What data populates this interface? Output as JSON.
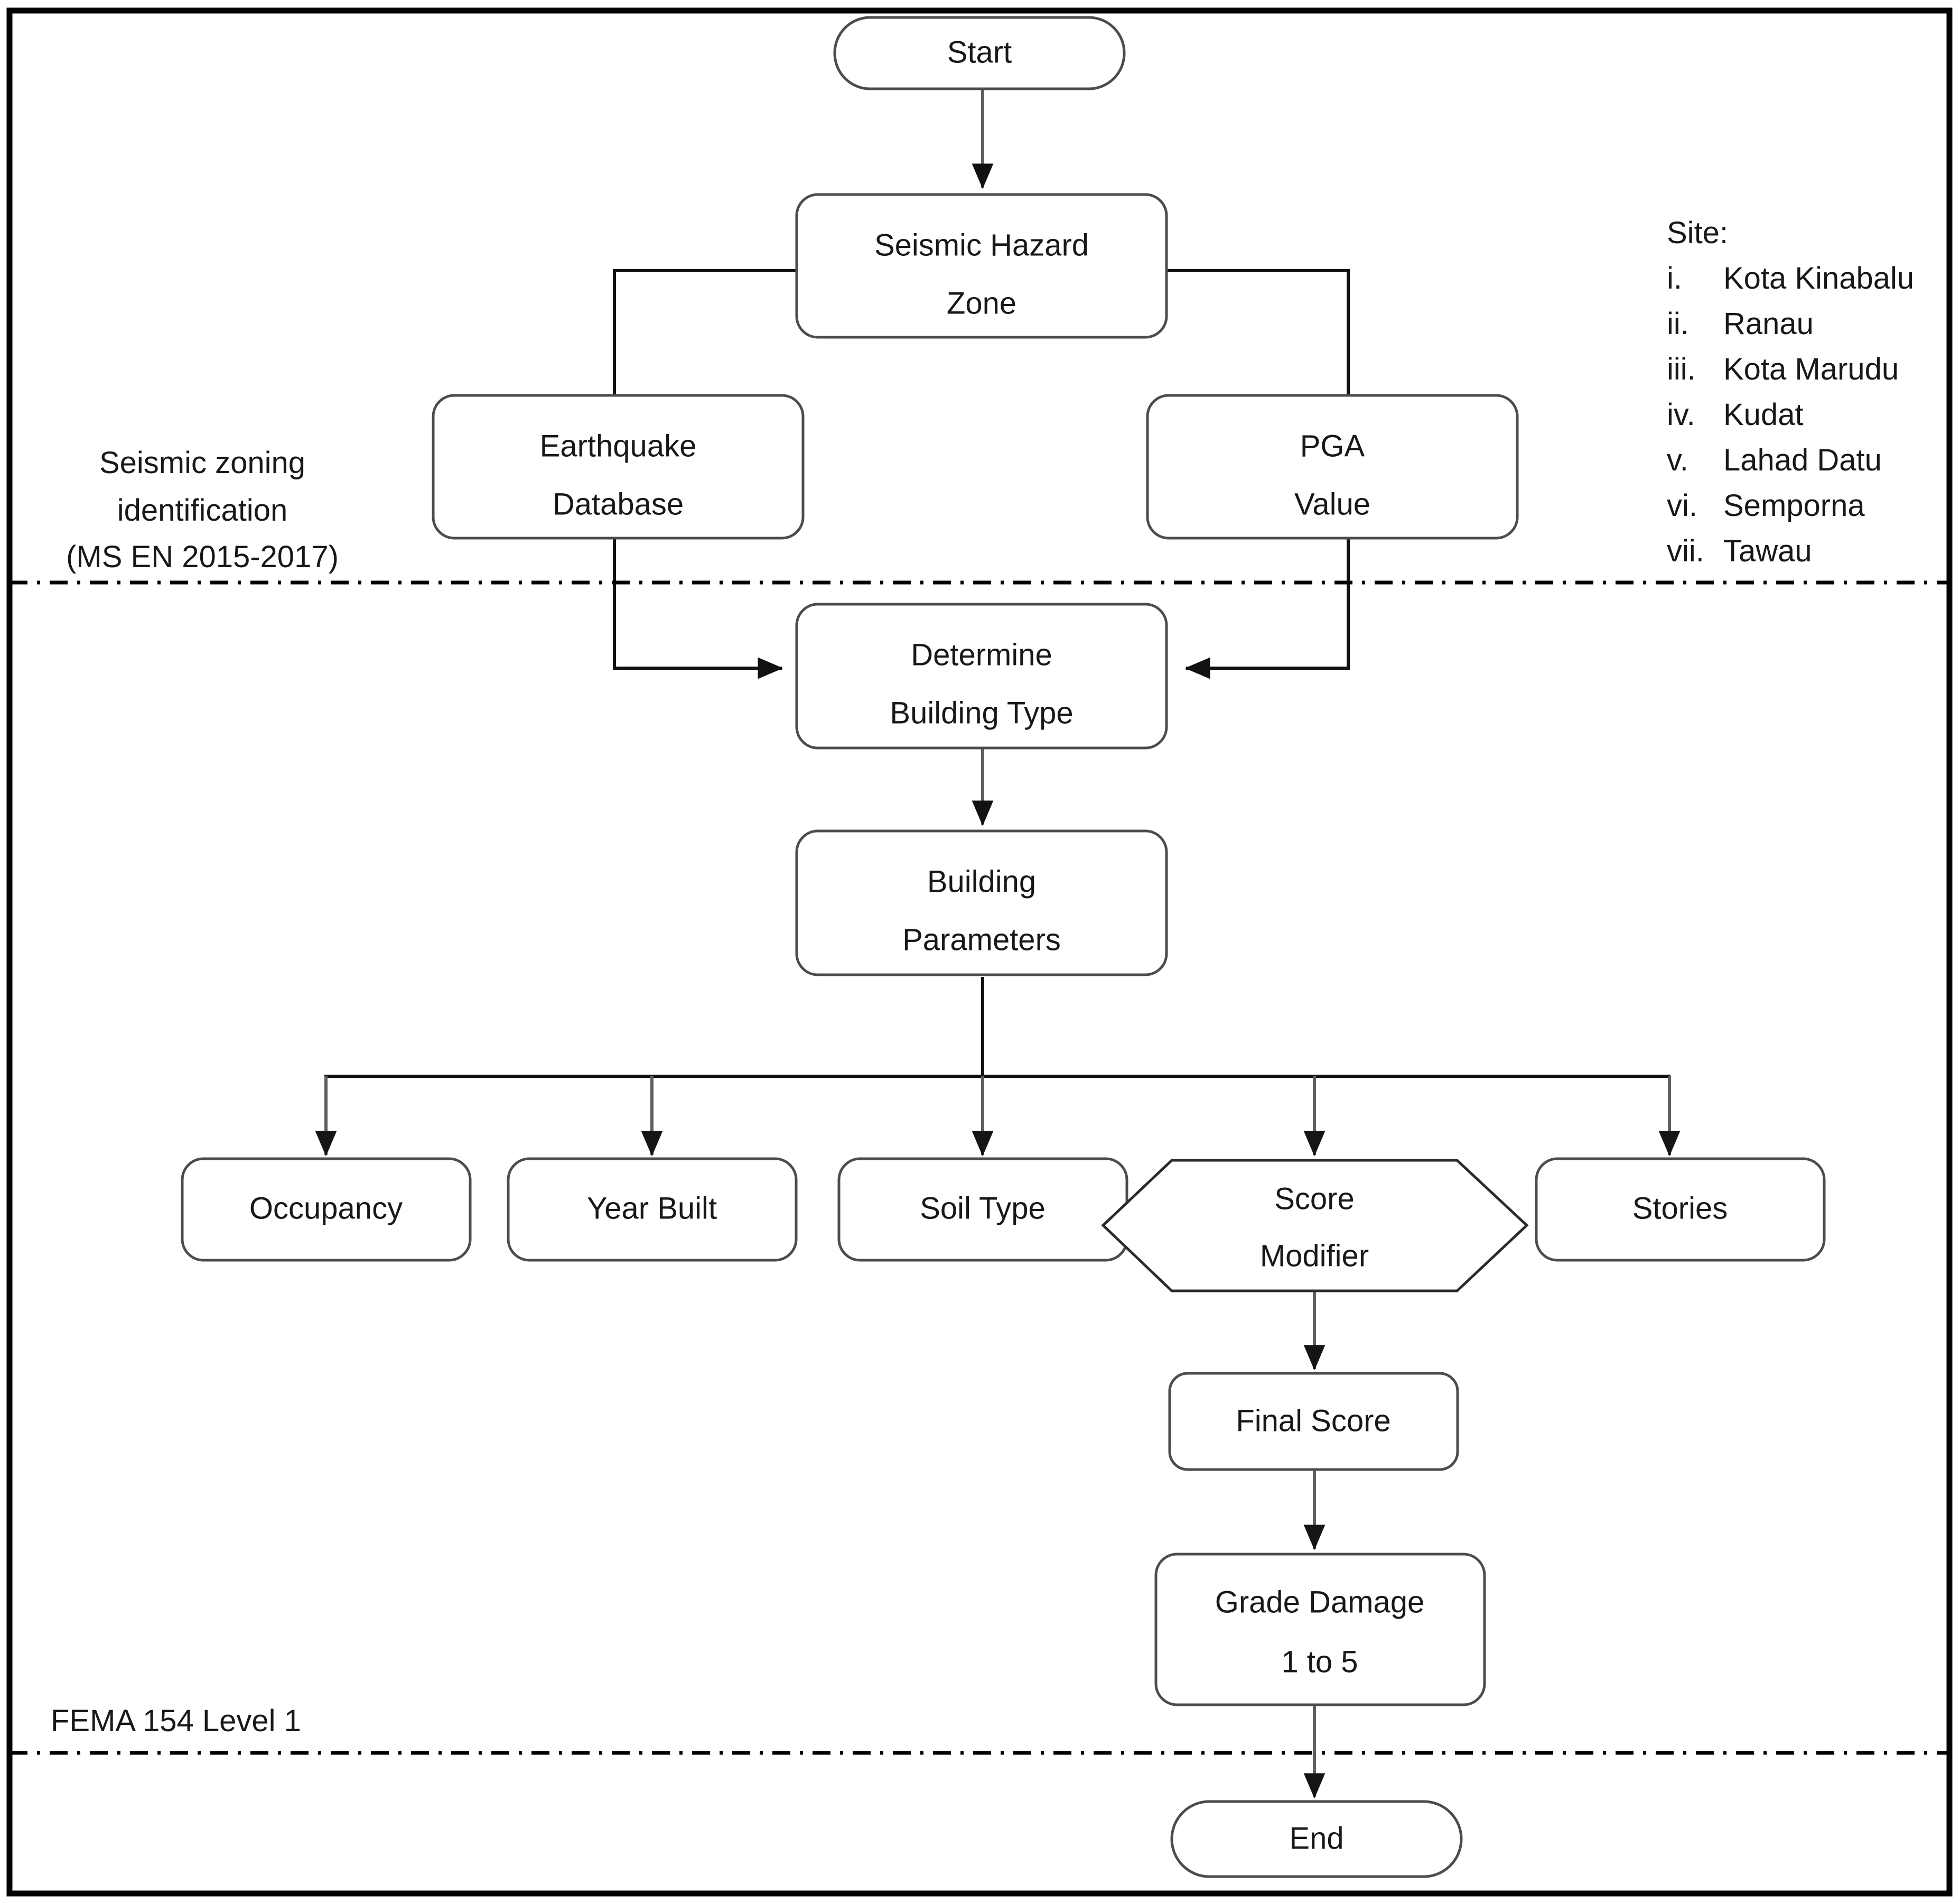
{
  "figure": {
    "type": "flowchart",
    "title": "Seismic vulnerability assessment flowchart",
    "background": "#ffffff",
    "frame_color": "#000000",
    "node_stroke": "#4c4c4c",
    "connector_color": "#5f5f5f",
    "text_color": "#17181a"
  },
  "nodes": {
    "start": {
      "label": "Start",
      "shape": "terminator"
    },
    "seismic_hazard_zone": {
      "line1": "Seismic Hazard",
      "line2": "Zone",
      "shape": "rounded-rect"
    },
    "earthquake_database": {
      "line1": "Earthquake",
      "line2": "Database",
      "shape": "rounded-rect"
    },
    "pga_value": {
      "line1": "PGA",
      "line2": "Value",
      "shape": "rounded-rect"
    },
    "determine_building_type": {
      "line1": "Determine",
      "line2": "Building Type",
      "shape": "rounded-rect"
    },
    "building_parameters": {
      "line1": "Building",
      "line2": "Parameters",
      "shape": "rounded-rect"
    },
    "occupancy": {
      "label": "Occupancy",
      "shape": "rounded-rect"
    },
    "year_built": {
      "label": "Year Built",
      "shape": "rounded-rect"
    },
    "soil_type": {
      "label": "Soil Type",
      "shape": "rounded-rect"
    },
    "score_modifier": {
      "line1": "Score",
      "line2": "Modifier",
      "shape": "hexagon"
    },
    "stories": {
      "label": "Stories",
      "shape": "rounded-rect"
    },
    "final_score": {
      "label": "Final Score",
      "shape": "rounded-rect"
    },
    "grade_damage": {
      "line1": "Grade Damage",
      "line2": "1 to 5",
      "shape": "rounded-rect"
    },
    "end": {
      "label": "End",
      "shape": "terminator"
    }
  },
  "annotations": {
    "seismic_zoning": {
      "line1": "Seismic zoning",
      "line2": "identification",
      "line3": "(MS EN 2015-2017)"
    },
    "fema": {
      "line1": "FEMA 154 Level 1"
    }
  },
  "site_panel": {
    "heading": "Site:",
    "items": [
      {
        "numeral": "i.",
        "name": "Kota Kinabalu"
      },
      {
        "numeral": "ii.",
        "name": "Ranau"
      },
      {
        "numeral": "iii.",
        "name": "Kota Marudu"
      },
      {
        "numeral": "iv.",
        "name": "Kudat"
      },
      {
        "numeral": "v.",
        "name": "Lahad Datu"
      },
      {
        "numeral": "vi.",
        "name": "Semporna"
      },
      {
        "numeral": "vii.",
        "name": "Tawau"
      }
    ]
  },
  "edges": [
    {
      "from": "start",
      "to": "seismic_hazard_zone"
    },
    {
      "from": "seismic_hazard_zone",
      "to": "determine_building_type",
      "via": "earthquake_database"
    },
    {
      "from": "seismic_hazard_zone",
      "to": "determine_building_type",
      "via": "pga_value"
    },
    {
      "from": "determine_building_type",
      "to": "building_parameters"
    },
    {
      "from": "building_parameters",
      "to": "occupancy"
    },
    {
      "from": "building_parameters",
      "to": "year_built"
    },
    {
      "from": "building_parameters",
      "to": "soil_type"
    },
    {
      "from": "building_parameters",
      "to": "score_modifier"
    },
    {
      "from": "building_parameters",
      "to": "stories"
    },
    {
      "from": "score_modifier",
      "to": "final_score"
    },
    {
      "from": "final_score",
      "to": "grade_damage"
    },
    {
      "from": "grade_damage",
      "to": "end"
    }
  ]
}
